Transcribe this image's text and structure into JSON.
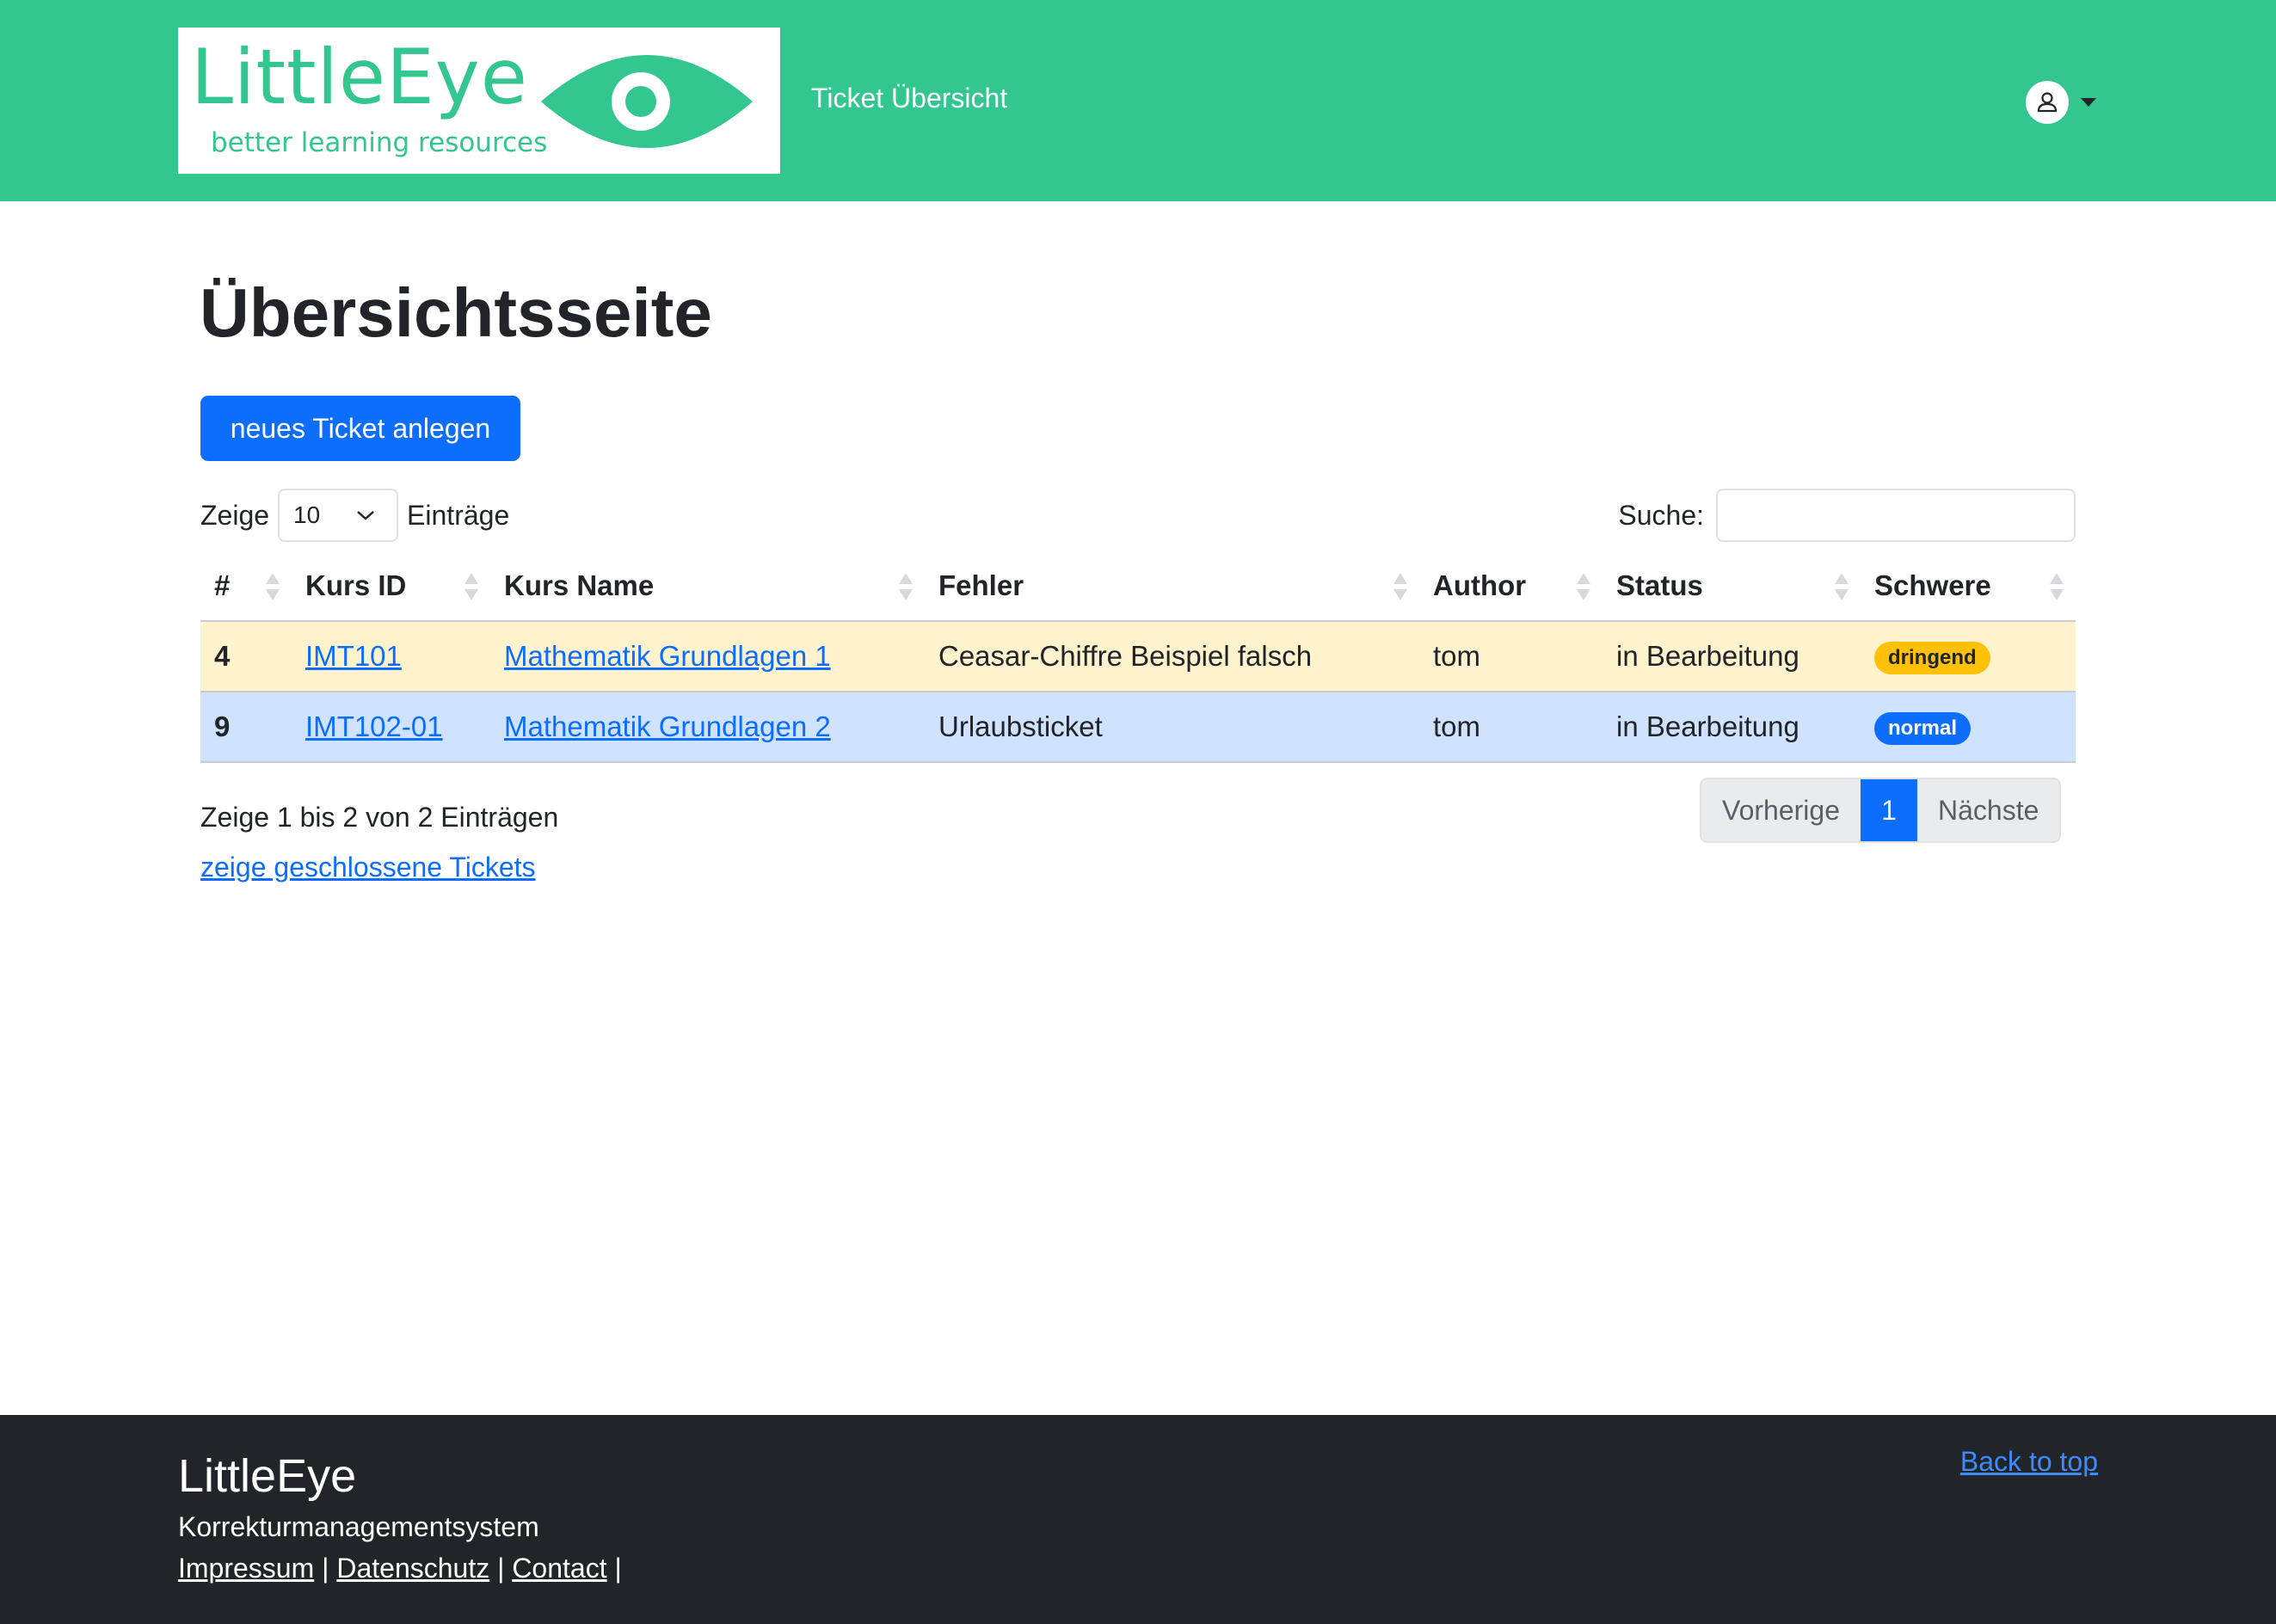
{
  "colors": {
    "brand": "#33c68e",
    "primary": "#0d6efd",
    "warning": "#ffc107",
    "row_warning": "#fff3cd",
    "row_info": "#cfe2ff",
    "footer": "#212529"
  },
  "header": {
    "logo_title": "LittleEye",
    "logo_subtitle": "better learning resources",
    "logo_icon": "eye-icon",
    "nav_link": "Ticket Übersicht",
    "user_icon": "user-icon"
  },
  "main": {
    "title": "Übersichtsseite",
    "new_ticket_button": "neues Ticket anlegen",
    "length": {
      "prefix": "Zeige",
      "value": "10",
      "suffix": "Einträge"
    },
    "search": {
      "label": "Suche:",
      "value": ""
    },
    "table": {
      "columns": [
        "#",
        "Kurs ID",
        "Kurs Name",
        "Fehler",
        "Author",
        "Status",
        "Schwere"
      ],
      "rows": [
        {
          "id": "4",
          "course_id": "IMT101",
          "course_name": "Mathematik Grundlagen 1",
          "error": "Ceasar-Chiffre Beispiel falsch",
          "author": "tom",
          "status": "in Bearbeitung",
          "severity": "dringend"
        },
        {
          "id": "9",
          "course_id": "IMT102-01",
          "course_name": "Mathematik Grundlagen 2",
          "error": "Urlaubsticket",
          "author": "tom",
          "status": "in Bearbeitung",
          "severity": "normal"
        }
      ]
    },
    "info": "Zeige 1 bis 2 von 2 Einträgen",
    "closed_link": "zeige geschlossene Tickets",
    "pagination": {
      "previous": "Vorherige",
      "current": "1",
      "next": "Nächste"
    }
  },
  "footer": {
    "title": "LittleEye",
    "subtitle": "Korrekturmanagementsystem",
    "links": [
      "Impressum",
      "Datenschutz",
      "Contact"
    ],
    "separator": "|",
    "back_to_top": "Back to top"
  }
}
